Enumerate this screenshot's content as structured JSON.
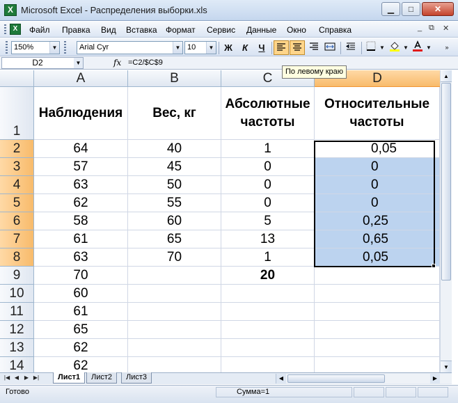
{
  "window": {
    "title": "Microsoft Excel - Распределения выборки.xls"
  },
  "menu": {
    "items": [
      "Файл",
      "Правка",
      "Вид",
      "Вставка",
      "Формат",
      "Сервис",
      "Данные",
      "Окно",
      "Справка"
    ],
    "mdi_controls": [
      "_",
      "⧉",
      "✕"
    ]
  },
  "toolbar": {
    "zoom": "150%",
    "font": "Arial Cyr",
    "size": "10",
    "bold": "Ж",
    "italic": "К",
    "underline": "Ч",
    "tooltip": "По левому краю"
  },
  "formula_bar": {
    "name_box": "D2",
    "fx": "fx",
    "formula": "=C2/$C$9"
  },
  "columns": [
    "A",
    "B",
    "C",
    "D"
  ],
  "rows": [
    "1",
    "2",
    "3",
    "4",
    "5",
    "6",
    "7",
    "8",
    "9",
    "10",
    "11",
    "12",
    "13",
    "14"
  ],
  "headers": {
    "a": "Наблюдения",
    "b": "Вес, кг",
    "c": "Абсолютные частоты",
    "d": "Относительные частоты"
  },
  "data": [
    {
      "a": "64",
      "b": "40",
      "c": "1",
      "d": "0,05"
    },
    {
      "a": "57",
      "b": "45",
      "c": "0",
      "d": "0"
    },
    {
      "a": "63",
      "b": "50",
      "c": "0",
      "d": "0"
    },
    {
      "a": "62",
      "b": "55",
      "c": "0",
      "d": "0"
    },
    {
      "a": "58",
      "b": "60",
      "c": "5",
      "d": "0,25"
    },
    {
      "a": "61",
      "b": "65",
      "c": "13",
      "d": "0,65"
    },
    {
      "a": "63",
      "b": "70",
      "c": "1",
      "d": "0,05"
    },
    {
      "a": "70",
      "b": "",
      "c": "20",
      "d": ""
    },
    {
      "a": "60",
      "b": "",
      "c": "",
      "d": ""
    },
    {
      "a": "61",
      "b": "",
      "c": "",
      "d": ""
    },
    {
      "a": "65",
      "b": "",
      "c": "",
      "d": ""
    },
    {
      "a": "62",
      "b": "",
      "c": "",
      "d": ""
    },
    {
      "a": "62",
      "b": "",
      "c": "",
      "d": ""
    }
  ],
  "sheets": [
    "Лист1",
    "Лист2",
    "Лист3"
  ],
  "status": {
    "ready": "Готово",
    "sum": "Сумма=1"
  },
  "colors": {
    "selection": "#bcd3ef",
    "header_selected": "#f8bb6b",
    "tooltip_bg": "#ffffe1"
  }
}
